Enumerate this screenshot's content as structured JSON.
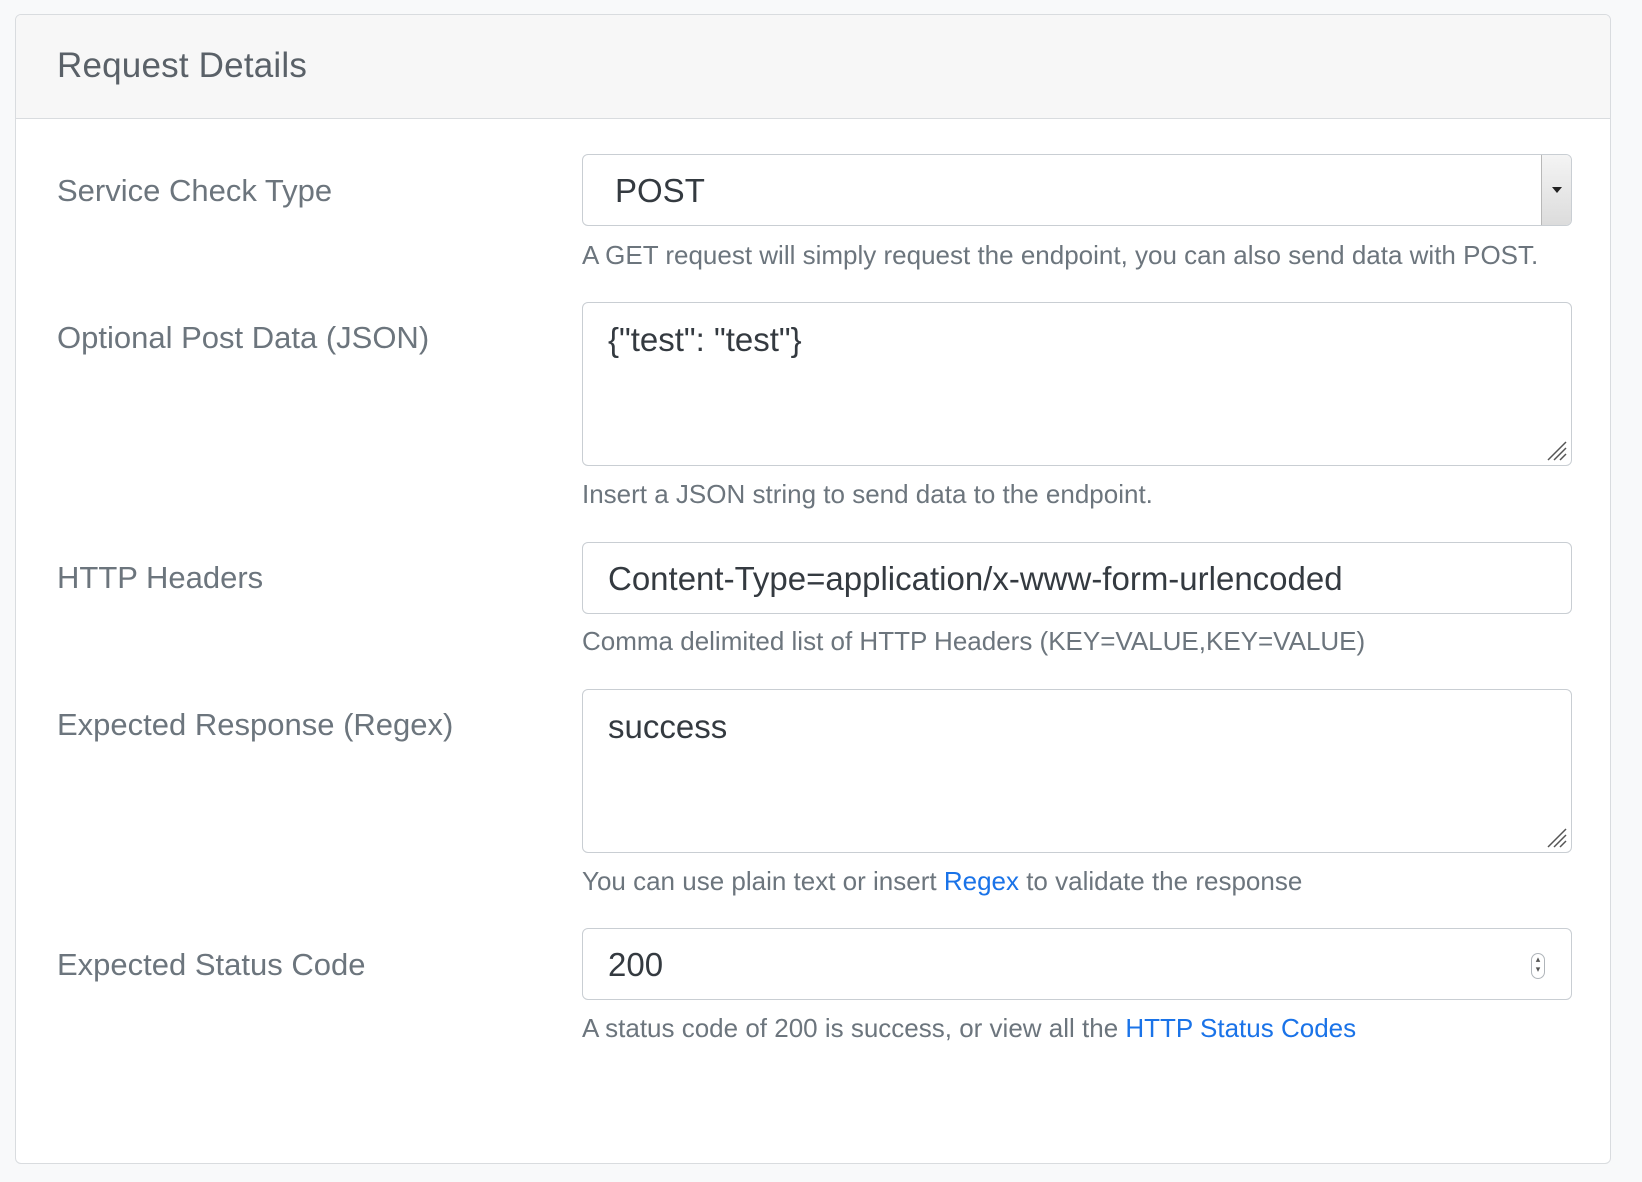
{
  "panel": {
    "title": "Request Details"
  },
  "fields": {
    "service_check_type": {
      "label": "Service Check Type",
      "value": "POST",
      "help": "A GET request will simply request the endpoint, you can also send data with POST."
    },
    "post_data": {
      "label": "Optional Post Data (JSON)",
      "value": "{\"test\": \"test\"}",
      "help": "Insert a JSON string to send data to the endpoint."
    },
    "http_headers": {
      "label": "HTTP Headers",
      "value": "Content-Type=application/x-www-form-urlencoded",
      "help": "Comma delimited list of HTTP Headers (KEY=VALUE,KEY=VALUE)"
    },
    "expected_response": {
      "label": "Expected Response (Regex)",
      "value": "success",
      "help_before": "You can use plain text or insert ",
      "help_link": "Regex",
      "help_after": " to validate the response"
    },
    "expected_status": {
      "label": "Expected Status Code",
      "value": "200",
      "help_before": "A status code of 200 is success, or view all the ",
      "help_link": "HTTP Status Codes"
    }
  },
  "icons": {
    "select": "chevron-down-icon",
    "resize": "resize-grip-icon",
    "spinner": "number-spinner-icon"
  },
  "colors": {
    "link": "#1a73e8",
    "label": "#6c757d",
    "border": "#c9ced3",
    "header_bg": "#f7f7f7"
  }
}
